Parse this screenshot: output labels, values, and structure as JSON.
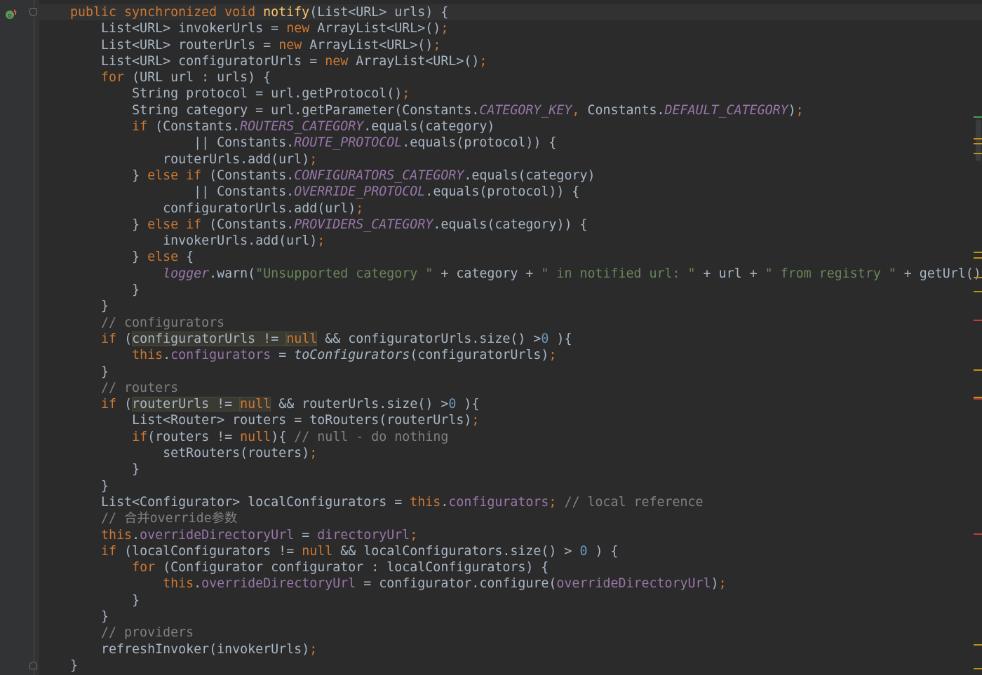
{
  "editor": {
    "theme_colors": {
      "background": "#2b2b2b",
      "keyword": "#cc7832",
      "method_decl": "#ffc66d",
      "constant": "#9876aa",
      "number": "#6897bb",
      "string": "#6a8759",
      "comment": "#808080",
      "text": "#a9b7c6"
    },
    "gutter_icons": {
      "override": "override-method-icon",
      "fold_top": "fold-collapse-icon",
      "fold_bottom": "fold-end-icon"
    },
    "lines": [
      {
        "indent": 0,
        "tokens": [
          [
            "kw",
            "public synchronized void "
          ],
          [
            "fn",
            "notify"
          ],
          [
            "",
            "(List<URL> urls) {"
          ]
        ]
      },
      {
        "indent": 1,
        "tokens": [
          [
            "",
            "List<URL> invokerUrls = "
          ],
          [
            "kw",
            "new "
          ],
          [
            "",
            "ArrayList<URL>()"
          ],
          [
            "kw",
            ";"
          ]
        ]
      },
      {
        "indent": 1,
        "tokens": [
          [
            "",
            "List<URL> routerUrls = "
          ],
          [
            "kw",
            "new "
          ],
          [
            "",
            "ArrayList<URL>()"
          ],
          [
            "kw",
            ";"
          ]
        ]
      },
      {
        "indent": 1,
        "tokens": [
          [
            "",
            "List<URL> configuratorUrls = "
          ],
          [
            "kw",
            "new "
          ],
          [
            "",
            "ArrayList<URL>()"
          ],
          [
            "kw",
            ";"
          ]
        ]
      },
      {
        "indent": 1,
        "tokens": [
          [
            "kw",
            "for "
          ],
          [
            "",
            "(URL url : urls) {"
          ]
        ]
      },
      {
        "indent": 2,
        "tokens": [
          [
            "",
            "String protocol = url.getProtocol()"
          ],
          [
            "kw",
            ";"
          ]
        ]
      },
      {
        "indent": 2,
        "tokens": [
          [
            "",
            "String category = url.getParameter(Constants."
          ],
          [
            "cst",
            "CATEGORY_KEY"
          ],
          [
            "kw",
            ", "
          ],
          [
            "",
            "Constants."
          ],
          [
            "cst",
            "DEFAULT_CATEGORY"
          ],
          [
            "",
            ")"
          ],
          [
            "kw",
            ";"
          ]
        ]
      },
      {
        "indent": 2,
        "tokens": [
          [
            "kw",
            "if "
          ],
          [
            "",
            "(Constants."
          ],
          [
            "cst",
            "ROUTERS_CATEGORY"
          ],
          [
            "",
            ".equals(category)"
          ]
        ]
      },
      {
        "indent": 4,
        "tokens": [
          [
            "",
            "|| Constants."
          ],
          [
            "cst",
            "ROUTE_PROTOCOL"
          ],
          [
            "",
            ".equals(protocol)) {"
          ]
        ]
      },
      {
        "indent": 3,
        "tokens": [
          [
            "",
            "routerUrls.add(url)"
          ],
          [
            "kw",
            ";"
          ]
        ]
      },
      {
        "indent": 2,
        "tokens": [
          [
            "",
            "} "
          ],
          [
            "kw",
            "else if "
          ],
          [
            "",
            "(Constants."
          ],
          [
            "cst",
            "CONFIGURATORS_CATEGORY"
          ],
          [
            "",
            ".equals(category)"
          ]
        ]
      },
      {
        "indent": 4,
        "tokens": [
          [
            "",
            "|| Constants."
          ],
          [
            "cst",
            "OVERRIDE_PROTOCOL"
          ],
          [
            "",
            ".equals(protocol)) {"
          ]
        ]
      },
      {
        "indent": 3,
        "tokens": [
          [
            "",
            "configuratorUrls.add(url)"
          ],
          [
            "kw",
            ";"
          ]
        ]
      },
      {
        "indent": 2,
        "tokens": [
          [
            "",
            "} "
          ],
          [
            "kw",
            "else if "
          ],
          [
            "",
            "(Constants."
          ],
          [
            "cst",
            "PROVIDERS_CATEGORY"
          ],
          [
            "",
            ".equals(category)) {"
          ]
        ]
      },
      {
        "indent": 3,
        "tokens": [
          [
            "",
            "invokerUrls.add(url)"
          ],
          [
            "kw",
            ";"
          ]
        ]
      },
      {
        "indent": 2,
        "tokens": [
          [
            "",
            "} "
          ],
          [
            "kw",
            "else "
          ],
          [
            "",
            "{"
          ]
        ]
      },
      {
        "indent": 3,
        "tokens": [
          [
            "cst",
            "logger"
          ],
          [
            "",
            ".warn("
          ],
          [
            "str",
            "\"Unsupported category \""
          ],
          [
            "",
            " + category + "
          ],
          [
            "str",
            "\" in notified url: \""
          ],
          [
            "",
            " + url + "
          ],
          [
            "str",
            "\" from registry \""
          ],
          [
            "",
            " + getUrl()"
          ]
        ]
      },
      {
        "indent": 2,
        "tokens": [
          [
            "",
            "}"
          ]
        ]
      },
      {
        "indent": 1,
        "tokens": [
          [
            "",
            "}"
          ]
        ]
      },
      {
        "indent": 1,
        "tokens": [
          [
            "cmt",
            "// configurators"
          ]
        ]
      },
      {
        "indent": 1,
        "tokens": [
          [
            "kw",
            "if "
          ],
          [
            "",
            "("
          ],
          [
            "hl",
            "configuratorUrls != "
          ],
          [
            "hlkw",
            "null"
          ],
          [
            "",
            " && configuratorUrls.size() >"
          ],
          [
            "num",
            "0"
          ],
          [
            "",
            " ){"
          ]
        ]
      },
      {
        "indent": 2,
        "tokens": [
          [
            "kw",
            "this"
          ],
          [
            "",
            "."
          ],
          [
            "fld",
            "configurators"
          ],
          [
            "",
            " = "
          ],
          [
            "ital",
            "toConfigurators"
          ],
          [
            "",
            "(configuratorUrls)"
          ],
          [
            "kw",
            ";"
          ]
        ]
      },
      {
        "indent": 1,
        "tokens": [
          [
            "",
            "}"
          ]
        ]
      },
      {
        "indent": 1,
        "tokens": [
          [
            "cmt",
            "// routers"
          ]
        ]
      },
      {
        "indent": 1,
        "tokens": [
          [
            "kw",
            "if "
          ],
          [
            "",
            "("
          ],
          [
            "hl",
            "routerUrls != "
          ],
          [
            "hlkw",
            "null"
          ],
          [
            "",
            " && routerUrls.size() >"
          ],
          [
            "num",
            "0"
          ],
          [
            "",
            " ){"
          ]
        ]
      },
      {
        "indent": 2,
        "tokens": [
          [
            "",
            "List<Router> routers = toRouters(routerUrls)"
          ],
          [
            "kw",
            ";"
          ]
        ]
      },
      {
        "indent": 2,
        "tokens": [
          [
            "kw",
            "if"
          ],
          [
            "",
            "(routers != "
          ],
          [
            "kw",
            "null"
          ],
          [
            "",
            "){ "
          ],
          [
            "cmt",
            "// null - do nothing"
          ]
        ]
      },
      {
        "indent": 3,
        "tokens": [
          [
            "",
            "setRouters(routers)"
          ],
          [
            "kw",
            ";"
          ]
        ]
      },
      {
        "indent": 2,
        "tokens": [
          [
            "",
            "}"
          ]
        ]
      },
      {
        "indent": 1,
        "tokens": [
          [
            "",
            "}"
          ]
        ]
      },
      {
        "indent": 1,
        "tokens": [
          [
            "",
            "List<Configurator> localConfigurators = "
          ],
          [
            "kw",
            "this"
          ],
          [
            "",
            "."
          ],
          [
            "fld",
            "configurators"
          ],
          [
            "kw",
            "; "
          ],
          [
            "cmt",
            "// local reference"
          ]
        ]
      },
      {
        "indent": 1,
        "tokens": [
          [
            "cmt",
            "// 合并override参数"
          ]
        ]
      },
      {
        "indent": 1,
        "tokens": [
          [
            "kw",
            "this"
          ],
          [
            "",
            "."
          ],
          [
            "fld",
            "overrideDirectoryUrl"
          ],
          [
            "",
            " = "
          ],
          [
            "fld",
            "directoryUrl"
          ],
          [
            "kw",
            ";"
          ]
        ]
      },
      {
        "indent": 1,
        "tokens": [
          [
            "kw",
            "if "
          ],
          [
            "",
            "(localConfigurators != "
          ],
          [
            "kw",
            "null "
          ],
          [
            "",
            "&& localConfigurators.size() > "
          ],
          [
            "num",
            "0"
          ],
          [
            "",
            " ) {"
          ]
        ]
      },
      {
        "indent": 2,
        "tokens": [
          [
            "kw",
            "for "
          ],
          [
            "",
            "(Configurator configurator : localConfigurators) {"
          ]
        ]
      },
      {
        "indent": 3,
        "tokens": [
          [
            "kw",
            "this"
          ],
          [
            "",
            "."
          ],
          [
            "fld",
            "overrideDirectoryUrl"
          ],
          [
            "",
            " = configurator.configure("
          ],
          [
            "fld",
            "overrideDirectoryUrl"
          ],
          [
            "",
            ")"
          ],
          [
            "kw",
            ";"
          ]
        ]
      },
      {
        "indent": 2,
        "tokens": [
          [
            "",
            "}"
          ]
        ]
      },
      {
        "indent": 1,
        "tokens": [
          [
            "",
            "}"
          ]
        ]
      },
      {
        "indent": 1,
        "tokens": [
          [
            "cmt",
            "// providers"
          ]
        ]
      },
      {
        "indent": 1,
        "tokens": [
          [
            "",
            "refreshInvoker(invokerUrls)"
          ],
          [
            "kw",
            ";"
          ]
        ]
      },
      {
        "indent": 0,
        "tokens": [
          [
            "",
            "}"
          ]
        ]
      }
    ],
    "scrollbar_markers": [
      {
        "color": "green",
        "pos": 0.172
      },
      {
        "color": "yellow",
        "pos": 0.205
      },
      {
        "color": "yellow",
        "pos": 0.212
      },
      {
        "color": "yellow",
        "pos": 0.226
      },
      {
        "color": "yellow",
        "pos": 0.373
      },
      {
        "color": "yellow",
        "pos": 0.381
      },
      {
        "color": "yellow",
        "pos": 0.41
      },
      {
        "color": "yellow",
        "pos": 0.431
      },
      {
        "color": "red",
        "pos": 0.474
      },
      {
        "color": "yellow",
        "pos": 0.547
      },
      {
        "color": "yellow",
        "pos": 0.588
      },
      {
        "color": "red",
        "pos": 0.59
      },
      {
        "color": "red",
        "pos": 0.79
      },
      {
        "color": "yellow",
        "pos": 0.954
      },
      {
        "color": "yellow",
        "pos": 0.99
      }
    ]
  }
}
